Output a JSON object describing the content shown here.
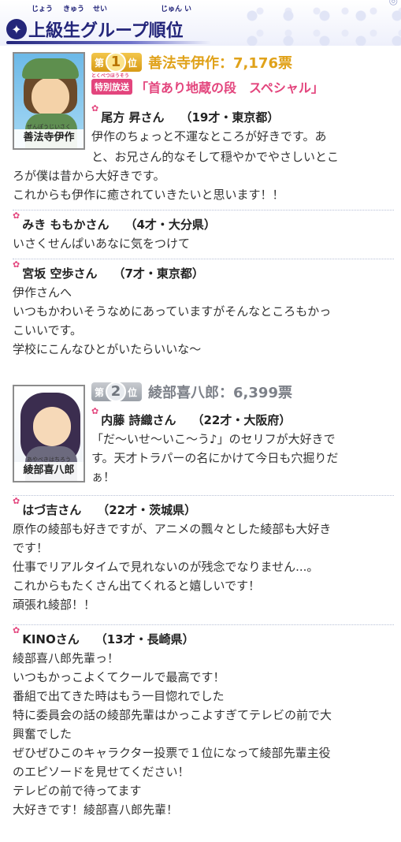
{
  "header": {
    "title": "上級生グループ順位",
    "ruby": [
      "じょう",
      "きゅう",
      "せい",
      "じゅん",
      "い"
    ]
  },
  "ranks": [
    {
      "badge_prefix": "第",
      "badge_number": "1",
      "badge_suffix": "位",
      "name_votes": "善法寺伊作：7,176票",
      "portrait_name": "善法寺伊作",
      "portrait_ruby": "ぜんぽうじいさく",
      "special": {
        "tag": "特別放送",
        "tag_ruby": "とくべつほうそう",
        "title": "「首あり地蔵の段　スペシャル」"
      },
      "comments": [
        {
          "name": "尾方 昇さん",
          "meta": "（19才・東京都）",
          "lines": [
            "伊作のちょっと不運なところが好きです。あ",
            "と、お兄さん的なそして穏やかでやさしいとこ",
            "ろが僕は昔から大好きです。",
            "これからも伊作に癒されていきたいと思います！！"
          ]
        },
        {
          "name": "みき ももかさん",
          "meta": "（4才・大分県）",
          "lines": [
            "いさくせんぱいあなに気をつけて"
          ]
        },
        {
          "name": "宮坂 空歩さん",
          "meta": "（7才・東京都）",
          "lines": [
            "伊作さんへ",
            "いつもかわいそうなめにあっていますがそんなところもかっ",
            "こいいです。",
            "学校にこんなひとがいたらいいな〜"
          ]
        }
      ]
    },
    {
      "badge_prefix": "第",
      "badge_number": "2",
      "badge_suffix": "位",
      "name_votes": "綾部喜八郎：6,399票",
      "portrait_name": "綾部喜八郎",
      "portrait_ruby": "あやべきはちろう",
      "comments": [
        {
          "name": "内藤 詩織さん",
          "meta": "（22才・大阪府）",
          "lines": [
            "「だ〜いせ〜いこ〜う♪」のセリフが大好きで",
            "す。天才トラパーの名にかけて今日も穴掘りだ",
            "ぁ！"
          ]
        },
        {
          "name": "はづ吉さん",
          "meta": "（22才・茨城県）",
          "lines": [
            "原作の綾部も好きですが、アニメの飄々とした綾部も大好き",
            "です！",
            "仕事でリアルタイムで見れないのが残念でなりません...。",
            "これからもたくさん出てくれると嬉しいです！",
            "頑張れ綾部！！"
          ]
        },
        {
          "name": "KINOさん",
          "meta": "（13才・長崎県）",
          "lines": [
            "綾部喜八郎先輩っ！",
            "いつもかっこよくてクールで最高です！",
            "番組で出てきた時はもう一目惚れでした",
            "特に委員会の話の綾部先輩はかっこよすぎてテレビの前で大",
            "興奮でした",
            "ぜひぜひこのキャラクター投票で１位になって綾部先輩主役",
            "のエピソードを見せてください！",
            "テレビの前で待ってます",
            "大好きです！綾部喜八郎先輩！"
          ]
        }
      ]
    }
  ]
}
